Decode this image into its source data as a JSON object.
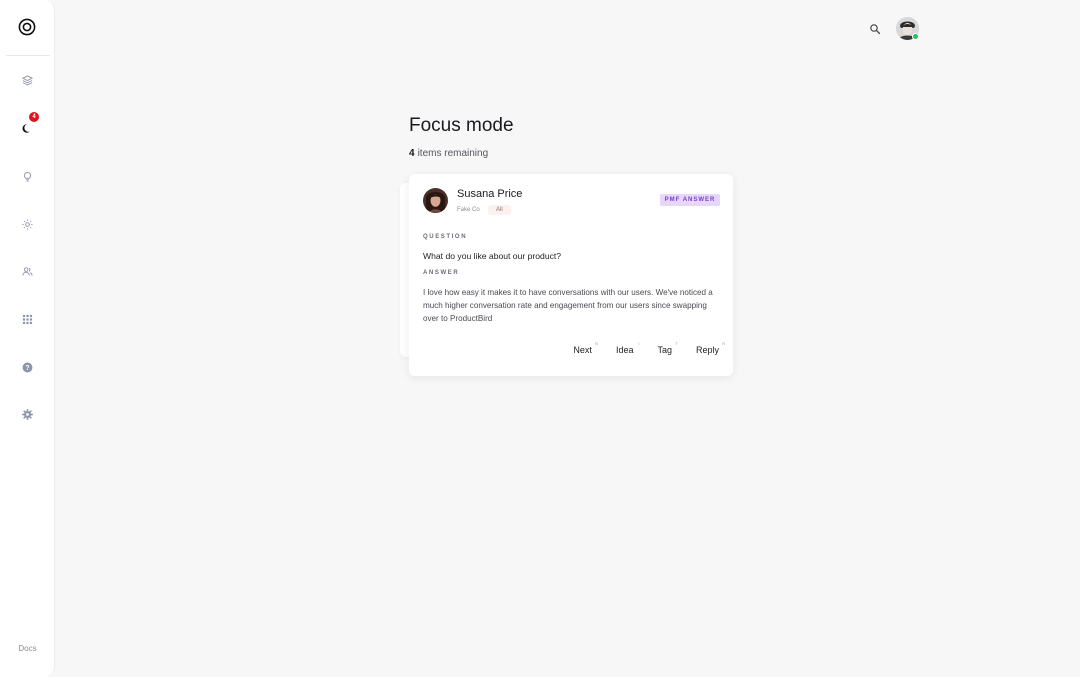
{
  "sidebar": {
    "logo": "target-logo-icon",
    "items": [
      {
        "name": "layers",
        "icon": "layers-icon"
      },
      {
        "name": "focus",
        "icon": "moon-icon",
        "badge": "4"
      },
      {
        "name": "ideas",
        "icon": "lightbulb-icon"
      },
      {
        "name": "theme",
        "icon": "sun-icon"
      },
      {
        "name": "users",
        "icon": "users-icon"
      },
      {
        "name": "apps",
        "icon": "grid-icon"
      },
      {
        "name": "help",
        "icon": "help-icon"
      },
      {
        "name": "settings",
        "icon": "gear-icon"
      }
    ],
    "docs_label": "Docs"
  },
  "header": {
    "search_icon": "search-icon",
    "avatar_status_color": "#22c55e"
  },
  "main": {
    "title": "Focus mode",
    "remaining_count": "4",
    "remaining_label": "items remaining"
  },
  "card": {
    "name": "Susana Price",
    "company": "Fake Co",
    "segment": "All",
    "type_badge": "PMF ANSWER",
    "question_label": "QUESTION",
    "question": "What do you like about our product?",
    "answer_label": "ANSWER",
    "answer": "I love how easy it makes it to have conversations with our users. We've noticed a much higher conversation rate and engagement from our users since swapping over to ProductBird",
    "actions": [
      {
        "label": "Next",
        "key": "N"
      },
      {
        "label": "Idea",
        "key": "I"
      },
      {
        "label": "Tag",
        "key": "T"
      },
      {
        "label": "Reply",
        "key": "R"
      }
    ]
  },
  "colors": {
    "accent_badge_bg": "#e7d6fb",
    "accent_badge_text": "#7a3fcf",
    "notification": "#e5121d"
  }
}
